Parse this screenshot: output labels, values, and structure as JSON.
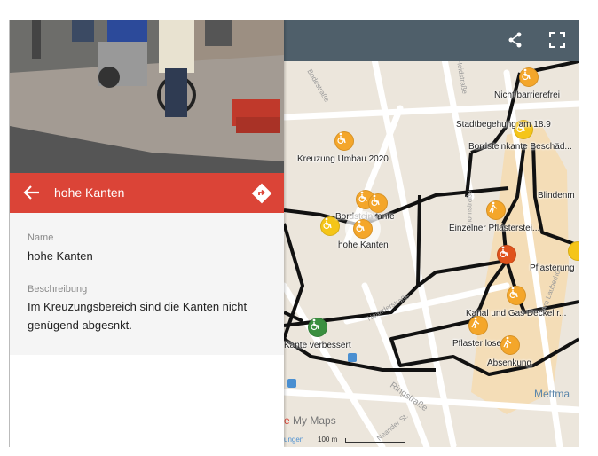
{
  "feature": {
    "title": "hohe Kanten",
    "name_label": "Name",
    "name_value": "hohe Kanten",
    "description_label": "Beschreibung",
    "description_line1": "Im Kreuzungsbereich sind die Kanten nicht",
    "description_line2": "genügend abgesnkt."
  },
  "map": {
    "markers": [
      {
        "label": "Nicht barrierefrei",
        "color": "#f4a62a"
      },
      {
        "label": "Stadtbegehung am 18.9",
        "color": "#f4a62a"
      },
      {
        "label": "Bordsteinkante Beschäd...",
        "color": "#f4a62a"
      },
      {
        "label": "Kreuzung Umbau 2020",
        "color": "#f4a62a"
      },
      {
        "label": "Blindenm",
        "color": "#f4a62a"
      },
      {
        "label": "Bordsteinkante",
        "color": "#f5c518"
      },
      {
        "label": "hohe Kanten",
        "color": "#f4a62a"
      },
      {
        "label": "Einzelner Pflasterstei...",
        "color": "#f4a62a"
      },
      {
        "label": "Pflasterung",
        "color": "#f5c518"
      },
      {
        "label": "Kanal und Gas Deckel r...",
        "color": "#f4a62a"
      },
      {
        "label": "Pflaster lose",
        "color": "#f4a62a"
      },
      {
        "label": "Absenkung",
        "color": "#f4a62a"
      },
      {
        "label": "Kante verbessert",
        "color": "#3a8f3f"
      },
      {
        "label": "",
        "color": "#e0531c"
      }
    ],
    "streets": [
      "Bodestraße",
      "Heidstraße",
      "Ahornstraße",
      "Neanderstraße",
      "Ringstraße",
      "Am Lauberhof",
      "Neander St."
    ],
    "city": "Mettma",
    "watermark": "My Maps",
    "watermark_prefix": "e",
    "scale": "100 m",
    "scale_prefix": "ungen"
  }
}
